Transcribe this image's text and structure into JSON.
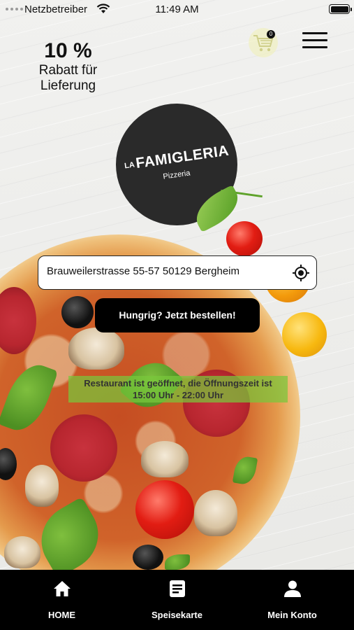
{
  "status_bar": {
    "carrier": "Netzbetreiber",
    "time": "11:49 AM"
  },
  "header": {
    "discount_value": "10 %",
    "discount_text": "Rabatt für Lieferung",
    "cart_count": "0"
  },
  "logo": {
    "prefix": "LA",
    "name": "FAMIGLERIA",
    "subtitle": "Pizzeria"
  },
  "address": {
    "value": "Brauweilerstrasse 55-57 50129 Bergheim"
  },
  "order_button": "Hungrig? Jetzt bestellen!",
  "open_status": "Restaurant ist geöffnet, die Öffnungszeit ist 15:00 Uhr - 22:00 Uhr",
  "tabbar": {
    "items": [
      {
        "label": "HOME",
        "icon": "home-icon"
      },
      {
        "label": "Speisekarte",
        "icon": "menu-card-icon"
      },
      {
        "label": "Mein Konto",
        "icon": "user-icon"
      }
    ]
  },
  "colors": {
    "tabbar_bg": "#000000",
    "button_bg": "#000000",
    "status_highlight": "#78c83c"
  }
}
